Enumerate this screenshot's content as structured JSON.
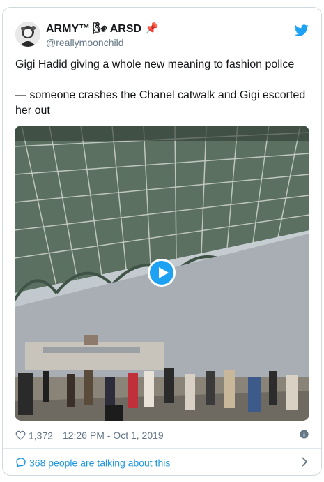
{
  "tweet": {
    "author": {
      "display_name": "ARMY™ 🌬 ARSD 📌",
      "handle": "@reallymoonchild"
    },
    "text_lines": [
      "Gigi Hadid giving a whole new meaning to fashion police",
      "— someone crashes the Chanel catwalk and Gigi escorted her out"
    ],
    "media": {
      "type": "video",
      "description_icon": "play-icon"
    },
    "likes": "1,372",
    "timestamp": "12:26 PM - Oct 1, 2019",
    "footer_link": "368 people are talking about this"
  },
  "colors": {
    "accent": "#1da1f2",
    "link": "#1b95e0",
    "muted": "#657786",
    "border": "#cfd9de"
  },
  "icons": [
    "twitter-bird-icon",
    "play-icon",
    "heart-icon",
    "info-icon",
    "speech-bubble-icon",
    "chevron-right-icon"
  ]
}
